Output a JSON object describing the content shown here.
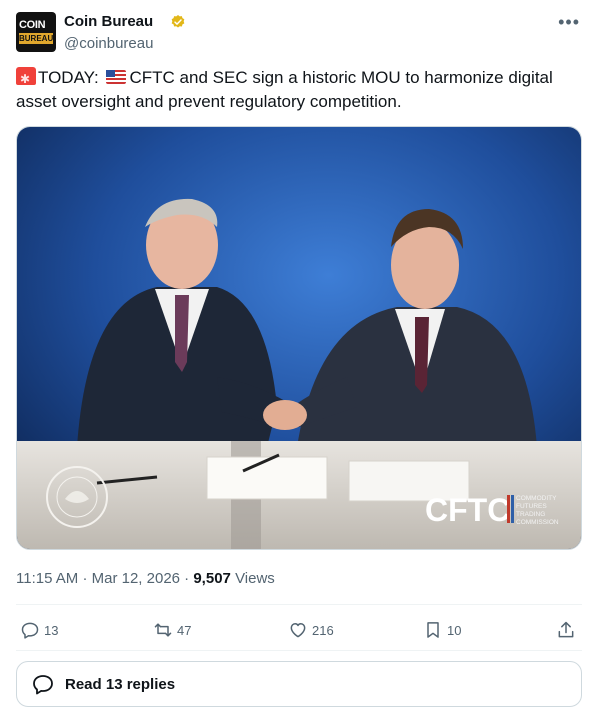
{
  "author": {
    "name": "Coin Bureau",
    "handle": "@coinbureau",
    "avatar_text_top": "COIN",
    "avatar_text_bottom": "BUREAU",
    "verified": true,
    "verified_color": "#e2b719"
  },
  "tweet": {
    "prefix": "TODAY:",
    "text": "CFTC and SEC sign a historic MOU to harmonize digital asset oversight and prevent regulatory competition.",
    "emojis": [
      "siren-emoji",
      "us-flag-emoji"
    ]
  },
  "media": {
    "cftc_wordmark": "CFTC",
    "cftc_subtitle": [
      "COMMODITY",
      "FUTURES",
      "TRADING",
      "COMMISSION"
    ]
  },
  "meta": {
    "time": "11:15 AM",
    "date": "Mar 12, 2026",
    "views_count": "9,507",
    "views_label": "Views"
  },
  "actions": {
    "replies": "13",
    "reposts": "47",
    "likes": "216",
    "bookmarks": "10"
  },
  "read_replies": {
    "label": "Read 13 replies"
  },
  "colors": {
    "text_primary": "#0f1419",
    "text_secondary": "#536471",
    "border": "#cfd9de"
  }
}
